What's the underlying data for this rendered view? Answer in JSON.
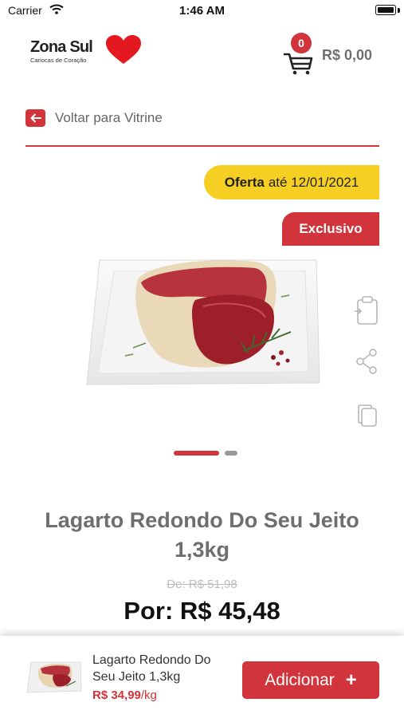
{
  "status_bar": {
    "carrier": "Carrier",
    "time": "1:46 AM"
  },
  "header": {
    "logo_name": "Zona Sul",
    "logo_tagline": "Cariocas de Coração",
    "cart_count": "0",
    "cart_total": "R$ 0,00"
  },
  "nav": {
    "back_label": "Voltar para Vitrine"
  },
  "badges": {
    "offer_strong": "Oferta",
    "offer_rest": "até 12/01/2021",
    "exclusive": "Exclusivo"
  },
  "carousel": {
    "pages": 2,
    "active_index": 0
  },
  "product": {
    "title": "Lagarto Redondo Do Seu Jeito 1,3kg",
    "old_price": "De: R$ 51,98",
    "new_price": "Por: R$ 45,48"
  },
  "bottom_bar": {
    "name": "Lagarto Redondo Do Seu Jeito 1,3kg",
    "price_value": "R$ 34,99",
    "price_unit": "/kg",
    "add_label": "Adicionar",
    "add_symbol": "+"
  },
  "colors": {
    "brand_red": "#d1343b",
    "offer_yellow": "#f5cf21"
  },
  "icons": [
    "wifi-icon",
    "battery-icon",
    "heart-logo-icon",
    "cart-icon",
    "arrow-left-icon",
    "clipboard-icon",
    "share-icon",
    "copy-icon",
    "plus-icon"
  ]
}
